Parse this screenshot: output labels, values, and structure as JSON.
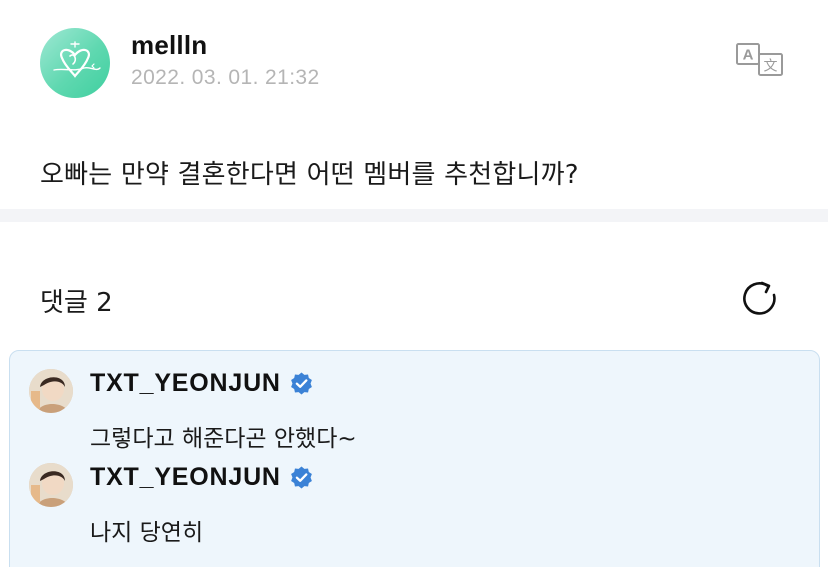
{
  "post": {
    "author": "mellln",
    "timestamp": "2022. 03. 01. 21:32",
    "body": "오빠는 만약 결혼한다면 어떤 멤버를 추천합니까?"
  },
  "comments_section": {
    "label": "댓글 2"
  },
  "comments": [
    {
      "author": "TXT_YEONJUN",
      "text": "그렇다고 해준다곤 안했다~"
    },
    {
      "author": "TXT_YEONJUN",
      "text": "나지 당연히"
    }
  ],
  "icons": {
    "translate": "translate-icon",
    "refresh": "refresh-icon",
    "verified": "verified-badge-icon"
  },
  "colors": {
    "avatar_gradient": "#5fd8b0",
    "timestamp": "#b5b5b5",
    "comment_highlight_bg": "#eef6fc",
    "comment_highlight_border": "#c9dff0",
    "verified_blue": "#3b82d6"
  }
}
